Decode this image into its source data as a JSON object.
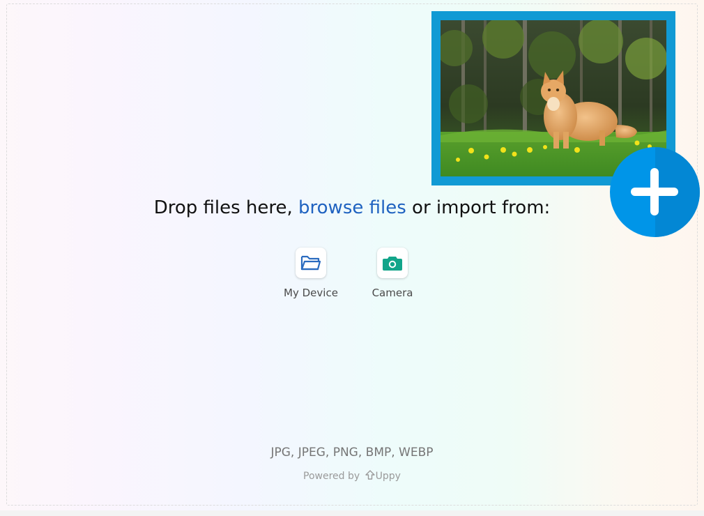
{
  "dropzone": {
    "prompt_before": "Drop files here, ",
    "browse_label": "browse files",
    "prompt_after": " or import from:"
  },
  "sources": [
    {
      "label": "My Device",
      "icon": "folder-icon"
    },
    {
      "label": "Camera",
      "icon": "camera-icon"
    }
  ],
  "formats_note": "JPG, JPEG, PNG, BMP, WEBP",
  "powered_by": {
    "prefix": "Powered by",
    "brand": "Uppy"
  },
  "add_button": {
    "icon": "plus-icon"
  },
  "colors": {
    "link": "#1f62c0",
    "frame": "#119ad4",
    "add_button": "#0095e8",
    "device_icon": "#2a6bbf",
    "camera_icon": "#13a58a"
  }
}
